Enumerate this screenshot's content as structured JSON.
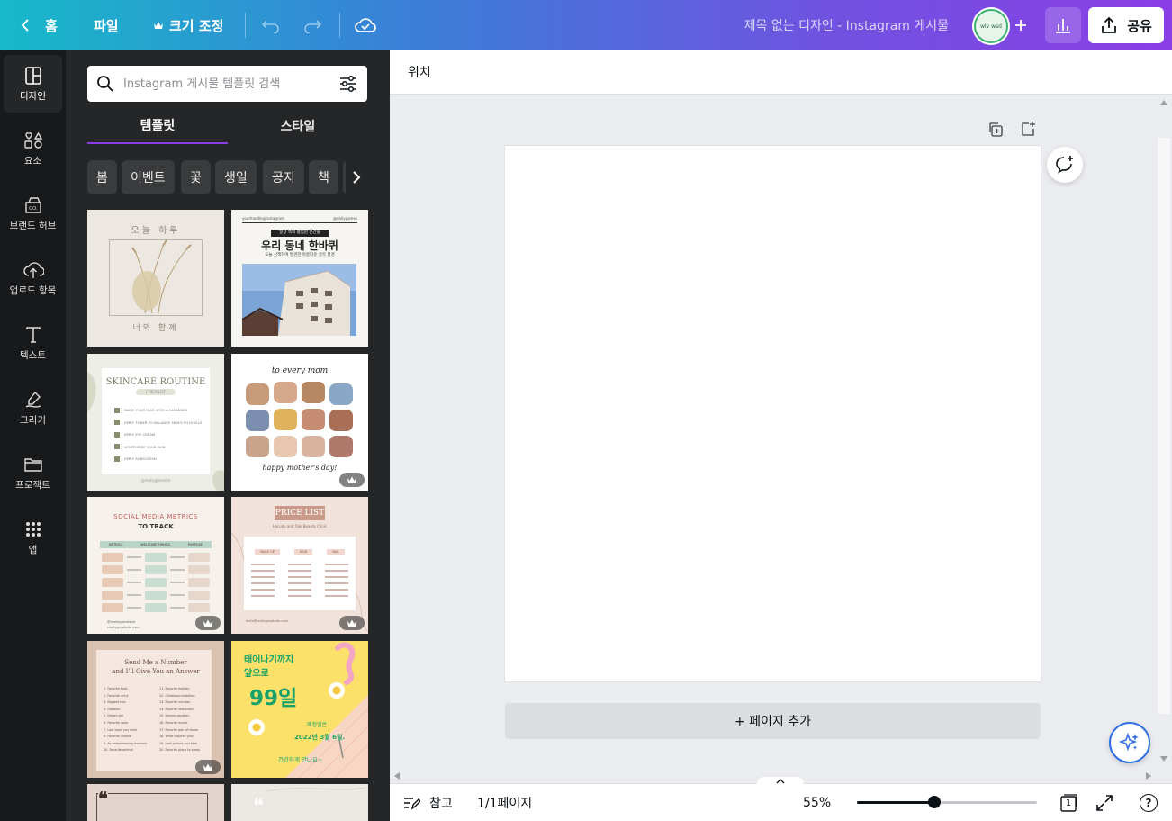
{
  "topbar": {
    "home": "홈",
    "file": "파일",
    "resize": "크기 조정",
    "doc_title": "제목 없는 디자인 - Instagram 게시물",
    "avatar_text": "wlv wsd",
    "share": "공유"
  },
  "rail": {
    "items": [
      {
        "label": "디자인",
        "icon": "design-icon"
      },
      {
        "label": "요소",
        "icon": "elements-icon"
      },
      {
        "label": "브랜드 허브",
        "icon": "brand-hub-icon"
      },
      {
        "label": "업로드 항목",
        "icon": "upload-icon"
      },
      {
        "label": "텍스트",
        "icon": "text-icon"
      },
      {
        "label": "그리기",
        "icon": "draw-icon"
      },
      {
        "label": "프로젝트",
        "icon": "folder-icon"
      },
      {
        "label": "앱",
        "icon": "apps-icon"
      }
    ]
  },
  "panel": {
    "search_placeholder": "Instagram 게시물 템플릿 검색",
    "tabs": [
      "템플릿",
      "스타일"
    ],
    "active_tab": 0,
    "chips": [
      "봄",
      "이벤트",
      "꽃",
      "생일",
      "공지",
      "책",
      "사"
    ],
    "templates": [
      {
        "top": "오늘 하루",
        "bottom": "너와 함께"
      },
      {
        "small_left": "yourhandle@instagram",
        "small_right": "@dailygames",
        "tag": "일상 속의 평범한 순간들",
        "title": "우리 동네 한바퀴",
        "subtitle": "오늘 산책하며 발견한 아름다운 골목 풍경"
      },
      {
        "title": "SKINCARE ROUTINE",
        "tag": "CHECKLIST",
        "items": [
          "WASH YOUR FACE WITH A CLEANSER",
          "APPLY TONER TO BALANCE SKIN'S PH LEVELS",
          "APPLY EYE CREAM",
          "MOISTURIZE YOUR SKIN",
          "APPLY SUNSCREEN"
        ],
        "footer": "@reallygreatsite"
      },
      {
        "top": "to every mom",
        "bottom": "happy mother's day!"
      },
      {
        "title": "SOCIAL MEDIA METRICS",
        "subtitle": "TO TRACK",
        "cols": [
          "METRICS",
          "WELCOME THINGS",
          "PURPOSE"
        ],
        "footer1": "@reallygreatsite",
        "footer2": "reallygreatsite.com"
      },
      {
        "title": "PRICE LIST",
        "subtitle": "Harumi and Tale Beauty Clinic",
        "cols": [
          "MAKE UP",
          "HAIR",
          "NAIL"
        ],
        "footer": "hello@reallygreatsite.com"
      },
      {
        "title1": "Send Me a Number",
        "title2": "and I'll Give You an Answer",
        "items": [
          "1. Favorite food",
          "2. Favorite drink",
          "3. Biggest fear",
          "4. Hobbies",
          "5. Dream Job",
          "6. Favorite color",
          "7. Last book you read",
          "8. Favorite quotes",
          "9. An embarrassing memory",
          "10. Favorite animal",
          "11. Favorite holiday",
          "12. Childhood ambition",
          "13. Favorite number",
          "14. Favorite restaurant",
          "15. Dream vacation",
          "16. Favorite movie",
          "17. Favorite pair of shoes",
          "18. What inspires you?",
          "19. Last picture you took",
          "20. Favorite place to sleep"
        ]
      },
      {
        "line1": "태어나기까지",
        "line2": "앞으로",
        "big": "99일",
        "due_label": "예정일은",
        "due": "2022년 3월 6일.",
        "closing": "건강하게 만나요~"
      }
    ],
    "crown_count": 5
  },
  "editor": {
    "position": "위치",
    "add_page": "+ 페이지 추가"
  },
  "bottombar": {
    "notes": "참고",
    "pages": "1/1페이지",
    "zoom": "55%",
    "zoom_fraction": 0.43,
    "page_count": "1",
    "help": "?"
  },
  "colors": {
    "gradient_start": "#17b9c9",
    "gradient_end": "#8b3ee6",
    "panel_bg": "#252627",
    "rail_bg": "#18191b",
    "accent": "#8b3ee6"
  }
}
